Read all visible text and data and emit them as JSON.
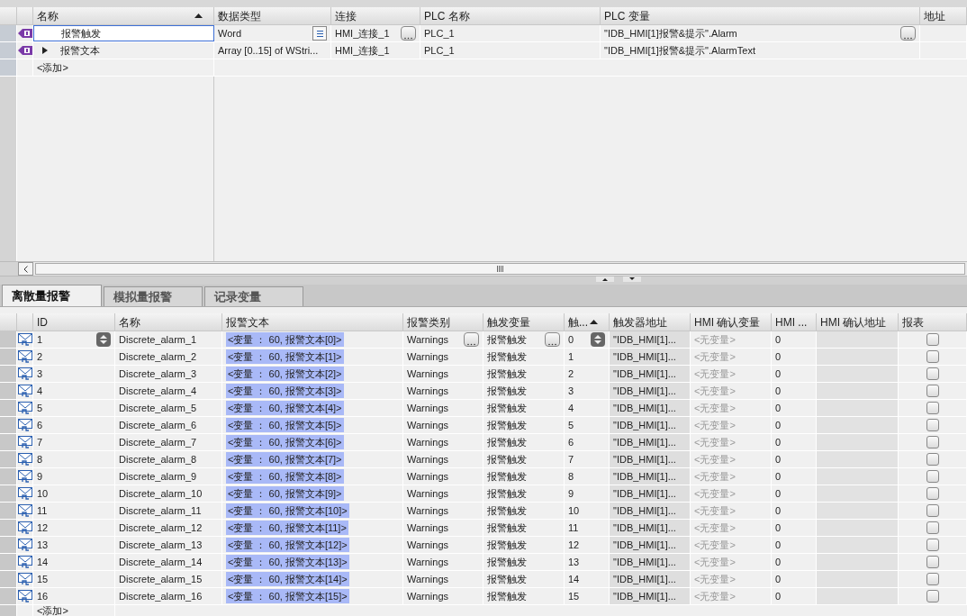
{
  "tag_table": {
    "columns": [
      {
        "label": "名称",
        "sorted": true
      },
      {
        "label": "数据类型",
        "sorted": false
      },
      {
        "label": "连接",
        "sorted": false
      },
      {
        "label": "PLC 名称",
        "sorted": false
      },
      {
        "label": "PLC 变量",
        "sorted": false
      },
      {
        "label": "地址",
        "sorted": false
      }
    ],
    "rows": [
      {
        "name": "报警触发",
        "has_children": false,
        "editing": true,
        "data_type": "Word",
        "connection": "HMI_连接_1",
        "plc_name": "PLC_1",
        "plc_tag": "\"IDB_HMI[1]报警&提示\".Alarm"
      },
      {
        "name": "报警文本",
        "has_children": true,
        "expanded": false,
        "editing": false,
        "data_type": "Array [0..15] of WStri...",
        "connection": "HMI_连接_1",
        "plc_name": "PLC_1",
        "plc_tag": "\"IDB_HMI[1]报警&提示\".AlarmText"
      }
    ],
    "add_row": "<添加>"
  },
  "tabs": [
    {
      "label": "离散量报警",
      "selected": true
    },
    {
      "label": "模拟量报警",
      "selected": false
    },
    {
      "label": "记录变量",
      "selected": false
    }
  ],
  "alarm_table": {
    "columns": [
      {
        "label": "ID",
        "sorted": false
      },
      {
        "label": "名称",
        "sorted": false
      },
      {
        "label": "报警文本",
        "sorted": false
      },
      {
        "label": "报警类别",
        "sorted": false
      },
      {
        "label": "触发变量",
        "sorted": false
      },
      {
        "label": "触...",
        "sorted": true
      },
      {
        "label": "触发器地址",
        "sorted": false
      },
      {
        "label": "HMI 确认变量",
        "sorted": false
      },
      {
        "label": "HMI ...",
        "sorted": false
      },
      {
        "label": "HMI 确认地址",
        "sorted": false
      },
      {
        "label": "报表",
        "sorted": false
      }
    ],
    "rows": [
      {
        "id": "1",
        "name": "Discrete_alarm_1",
        "text": "<变量 ： 60, 报警文本[0]>",
        "class": "Warnings",
        "trigger_tag": "报警触发",
        "bit": "0",
        "trigger_address": "\"IDB_HMI[1]...",
        "ack_tag": "<无变量>",
        "ack_bit": "0",
        "report": false,
        "focused": true
      },
      {
        "id": "2",
        "name": "Discrete_alarm_2",
        "text": "<变量 ： 60, 报警文本[1]>",
        "class": "Warnings",
        "trigger_tag": "报警触发",
        "bit": "1",
        "trigger_address": "\"IDB_HMI[1]...",
        "ack_tag": "<无变量>",
        "ack_bit": "0",
        "report": false,
        "focused": false
      },
      {
        "id": "3",
        "name": "Discrete_alarm_3",
        "text": "<变量 ： 60, 报警文本[2]>",
        "class": "Warnings",
        "trigger_tag": "报警触发",
        "bit": "2",
        "trigger_address": "\"IDB_HMI[1]...",
        "ack_tag": "<无变量>",
        "ack_bit": "0",
        "report": false,
        "focused": false
      },
      {
        "id": "4",
        "name": "Discrete_alarm_4",
        "text": "<变量 ： 60, 报警文本[3]>",
        "class": "Warnings",
        "trigger_tag": "报警触发",
        "bit": "3",
        "trigger_address": "\"IDB_HMI[1]...",
        "ack_tag": "<无变量>",
        "ack_bit": "0",
        "report": false,
        "focused": false
      },
      {
        "id": "5",
        "name": "Discrete_alarm_5",
        "text": "<变量 ： 60, 报警文本[4]>",
        "class": "Warnings",
        "trigger_tag": "报警触发",
        "bit": "4",
        "trigger_address": "\"IDB_HMI[1]...",
        "ack_tag": "<无变量>",
        "ack_bit": "0",
        "report": false,
        "focused": false
      },
      {
        "id": "6",
        "name": "Discrete_alarm_6",
        "text": "<变量 ： 60, 报警文本[5]>",
        "class": "Warnings",
        "trigger_tag": "报警触发",
        "bit": "5",
        "trigger_address": "\"IDB_HMI[1]...",
        "ack_tag": "<无变量>",
        "ack_bit": "0",
        "report": false,
        "focused": false
      },
      {
        "id": "7",
        "name": "Discrete_alarm_7",
        "text": "<变量 ： 60, 报警文本[6]>",
        "class": "Warnings",
        "trigger_tag": "报警触发",
        "bit": "6",
        "trigger_address": "\"IDB_HMI[1]...",
        "ack_tag": "<无变量>",
        "ack_bit": "0",
        "report": false,
        "focused": false
      },
      {
        "id": "8",
        "name": "Discrete_alarm_8",
        "text": "<变量 ： 60, 报警文本[7]>",
        "class": "Warnings",
        "trigger_tag": "报警触发",
        "bit": "7",
        "trigger_address": "\"IDB_HMI[1]...",
        "ack_tag": "<无变量>",
        "ack_bit": "0",
        "report": false,
        "focused": false
      },
      {
        "id": "9",
        "name": "Discrete_alarm_9",
        "text": "<变量 ： 60, 报警文本[8]>",
        "class": "Warnings",
        "trigger_tag": "报警触发",
        "bit": "8",
        "trigger_address": "\"IDB_HMI[1]...",
        "ack_tag": "<无变量>",
        "ack_bit": "0",
        "report": false,
        "focused": false
      },
      {
        "id": "10",
        "name": "Discrete_alarm_10",
        "text": "<变量 ： 60, 报警文本[9]>",
        "class": "Warnings",
        "trigger_tag": "报警触发",
        "bit": "9",
        "trigger_address": "\"IDB_HMI[1]...",
        "ack_tag": "<无变量>",
        "ack_bit": "0",
        "report": false,
        "focused": false
      },
      {
        "id": "11",
        "name": "Discrete_alarm_11",
        "text": "<变量 ： 60, 报警文本[10]>",
        "class": "Warnings",
        "trigger_tag": "报警触发",
        "bit": "10",
        "trigger_address": "\"IDB_HMI[1]...",
        "ack_tag": "<无变量>",
        "ack_bit": "0",
        "report": false,
        "focused": false
      },
      {
        "id": "12",
        "name": "Discrete_alarm_12",
        "text": "<变量 ： 60, 报警文本[11]>",
        "class": "Warnings",
        "trigger_tag": "报警触发",
        "bit": "11",
        "trigger_address": "\"IDB_HMI[1]...",
        "ack_tag": "<无变量>",
        "ack_bit": "0",
        "report": false,
        "focused": false
      },
      {
        "id": "13",
        "name": "Discrete_alarm_13",
        "text": "<变量 ： 60, 报警文本[12]>",
        "class": "Warnings",
        "trigger_tag": "报警触发",
        "bit": "12",
        "trigger_address": "\"IDB_HMI[1]...",
        "ack_tag": "<无变量>",
        "ack_bit": "0",
        "report": false,
        "focused": false
      },
      {
        "id": "14",
        "name": "Discrete_alarm_14",
        "text": "<变量 ： 60, 报警文本[13]>",
        "class": "Warnings",
        "trigger_tag": "报警触发",
        "bit": "13",
        "trigger_address": "\"IDB_HMI[1]...",
        "ack_tag": "<无变量>",
        "ack_bit": "0",
        "report": false,
        "focused": false
      },
      {
        "id": "15",
        "name": "Discrete_alarm_15",
        "text": "<变量 ： 60, 报警文本[14]>",
        "class": "Warnings",
        "trigger_tag": "报警触发",
        "bit": "14",
        "trigger_address": "\"IDB_HMI[1]...",
        "ack_tag": "<无变量>",
        "ack_bit": "0",
        "report": false,
        "focused": false
      },
      {
        "id": "16",
        "name": "Discrete_alarm_16",
        "text": "<变量 ： 60, 报警文本[15]>",
        "class": "Warnings",
        "trigger_tag": "报警触发",
        "bit": "15",
        "trigger_address": "\"IDB_HMI[1]...",
        "ack_tag": "<无变量>",
        "ack_bit": "0",
        "report": false,
        "focused": false
      }
    ],
    "add_row": "<添加>"
  }
}
